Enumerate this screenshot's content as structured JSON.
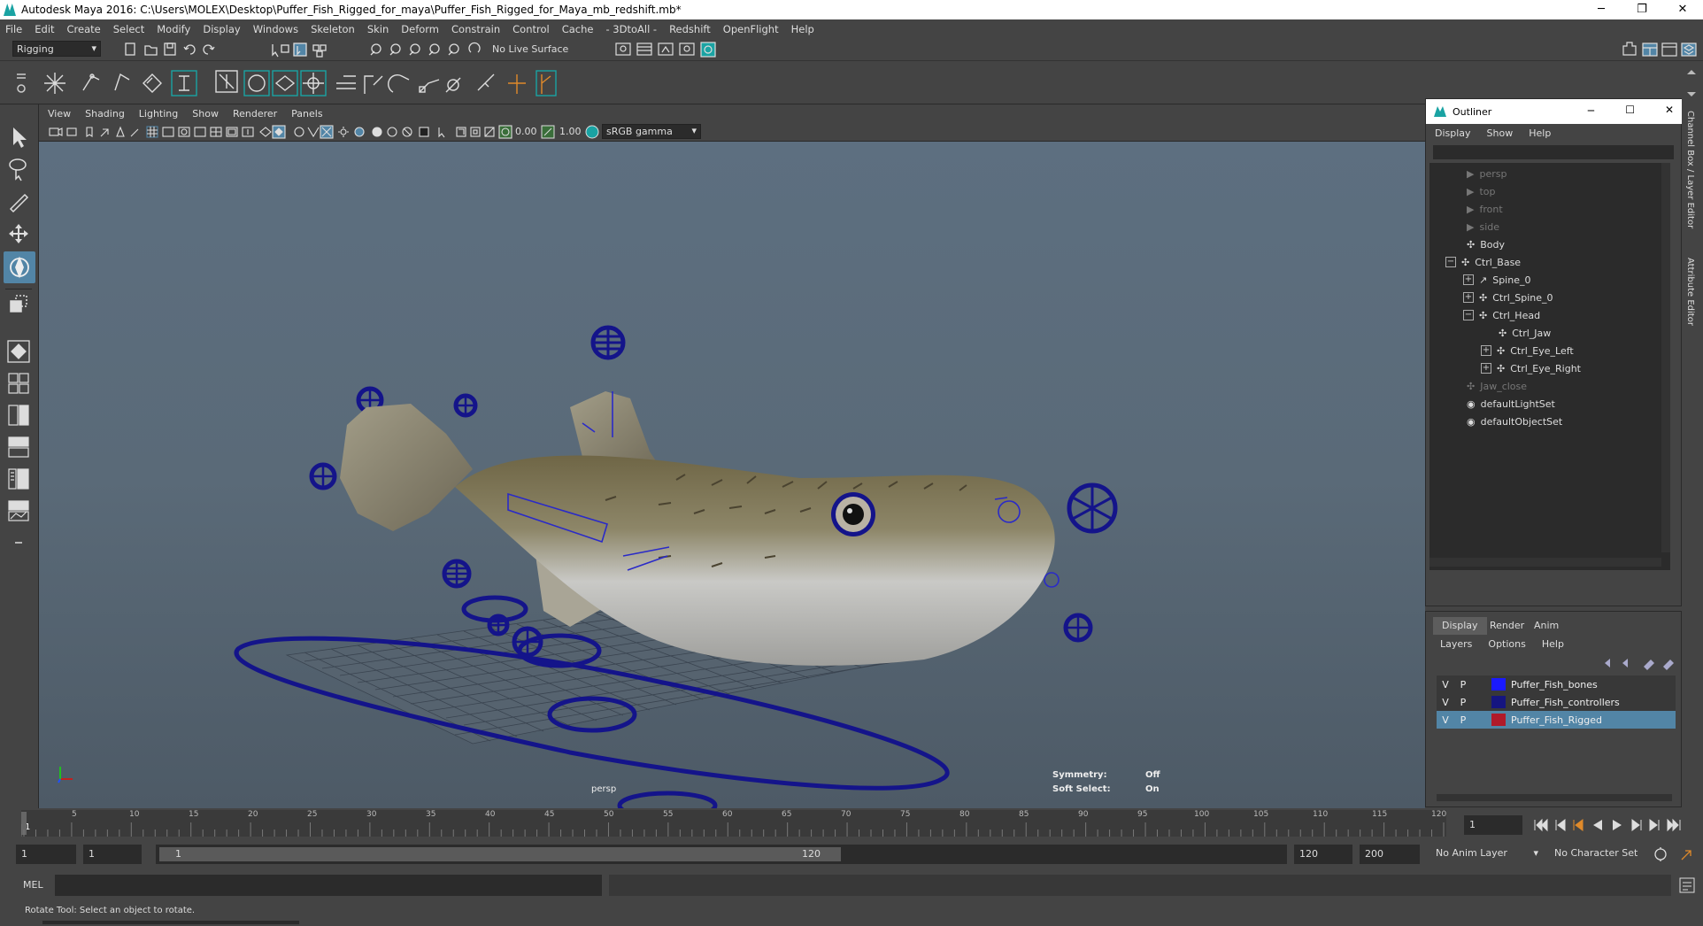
{
  "window": {
    "title": "Autodesk Maya 2016: C:\\Users\\MOLEX\\Desktop\\Puffer_Fish_Rigged_for_maya\\Puffer_Fish_Rigged_for_Maya_mb_redshift.mb*",
    "minimize": "─",
    "restore": "❐",
    "close": "✕"
  },
  "menubar": [
    "File",
    "Edit",
    "Create",
    "Select",
    "Modify",
    "Display",
    "Windows",
    "Skeleton",
    "Skin",
    "Deform",
    "Constrain",
    "Control",
    "Cache",
    "- 3DtoAll -",
    "Redshift",
    "OpenFlight",
    "Help"
  ],
  "statusline": {
    "menuset": "Rigging",
    "live_surface": "No Live Surface"
  },
  "viewport": {
    "menu": [
      "View",
      "Shading",
      "Lighting",
      "Show",
      "Renderer",
      "Panels"
    ],
    "exposure": "0.00",
    "gamma": "1.00",
    "colorspace": "sRGB gamma",
    "camera_label": "persp",
    "symmetry_label": "Symmetry:",
    "symmetry_value": "Off",
    "soft_select_label": "Soft Select:",
    "soft_select_value": "On"
  },
  "outliner": {
    "title": "Outliner",
    "menu": [
      "Display",
      "Show",
      "Help"
    ],
    "items": [
      {
        "label": "persp",
        "dim": true
      },
      {
        "label": "top",
        "dim": true
      },
      {
        "label": "front",
        "dim": true
      },
      {
        "label": "side",
        "dim": true
      },
      {
        "label": "Body",
        "dim": false
      },
      {
        "label": "Ctrl_Base",
        "dim": false
      },
      {
        "label": "Spine_0",
        "dim": false
      },
      {
        "label": "Ctrl_Spine_0",
        "dim": false
      },
      {
        "label": "Ctrl_Head",
        "dim": false
      },
      {
        "label": "Ctrl_Jaw",
        "dim": false
      },
      {
        "label": "Ctrl_Eye_Left",
        "dim": false
      },
      {
        "label": "Ctrl_Eye_Right",
        "dim": false
      },
      {
        "label": "Jaw_close",
        "dim": true
      },
      {
        "label": "defaultLightSet",
        "dim": false
      },
      {
        "label": "defaultObjectSet",
        "dim": false
      }
    ]
  },
  "layer_editor": {
    "tabs": [
      "Display",
      "Render",
      "Anim"
    ],
    "menu": [
      "Layers",
      "Options",
      "Help"
    ],
    "layers": [
      {
        "v": "V",
        "p": "P",
        "name": "Puffer_Fish_bones",
        "color": "#1a1aff",
        "selected": false
      },
      {
        "v": "V",
        "p": "P",
        "name": "Puffer_Fish_controllers",
        "color": "#151580",
        "selected": false
      },
      {
        "v": "V",
        "p": "P",
        "name": "Puffer_Fish_Rigged",
        "color": "#b01a2a",
        "selected": true
      }
    ]
  },
  "right_strip": {
    "channel_box": "Channel Box / Layer Editor",
    "attribute_editor": "Attribute Editor"
  },
  "timeline": {
    "ticks": [
      "5",
      "10",
      "15",
      "20",
      "25",
      "30",
      "35",
      "40",
      "45",
      "50",
      "55",
      "60",
      "65",
      "70",
      "75",
      "80",
      "85",
      "90",
      "95",
      "100",
      "105",
      "110",
      "115",
      "120"
    ],
    "start_tick": "1",
    "current_frame": "1",
    "range_start": "1",
    "range_inner_start": "1",
    "range_slider_start": "1",
    "range_slider_end": "120",
    "range_end": "120",
    "anim_end": "200",
    "anim_layer": "No Anim Layer",
    "character_set": "No Character Set"
  },
  "cmdline": {
    "label": "MEL"
  },
  "helpline": {
    "text": "Rotate Tool: Select an object to rotate."
  },
  "colors": {
    "controller": "#14148a",
    "layer_selected": "#5285a6"
  }
}
